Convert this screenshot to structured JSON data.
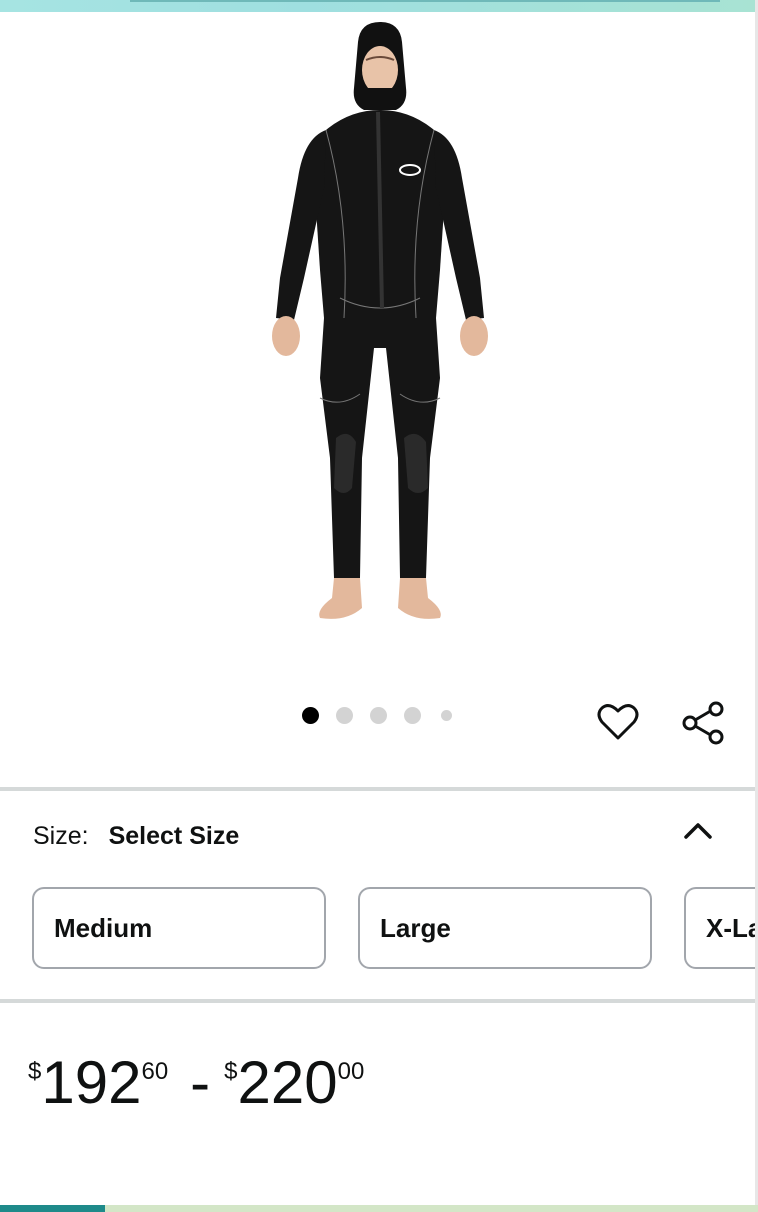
{
  "gallery": {
    "image_alt": "Men's full body hooded wetsuit",
    "dot_count": 5,
    "active_index": 0,
    "favorite_icon": "heart-icon",
    "share_icon": "share-icon",
    "brand_mark_color": "#ffffff"
  },
  "size": {
    "label": "Size:",
    "value": "Select Size",
    "collapse_icon": "chevron-up-icon",
    "options": [
      {
        "label": "Medium"
      },
      {
        "label": "Large"
      },
      {
        "label": "X-La"
      }
    ]
  },
  "price": {
    "low": {
      "currency": "$",
      "whole": "192",
      "fraction": "60"
    },
    "separator": "-",
    "high": {
      "currency": "$",
      "whole": "220",
      "fraction": "00"
    }
  },
  "colors": {
    "text": "#0f1111",
    "divider": "#d5d9d9",
    "option_border": "#a2a6ac",
    "dot_active": "#000000",
    "dot_inactive": "#d3d3d3"
  }
}
